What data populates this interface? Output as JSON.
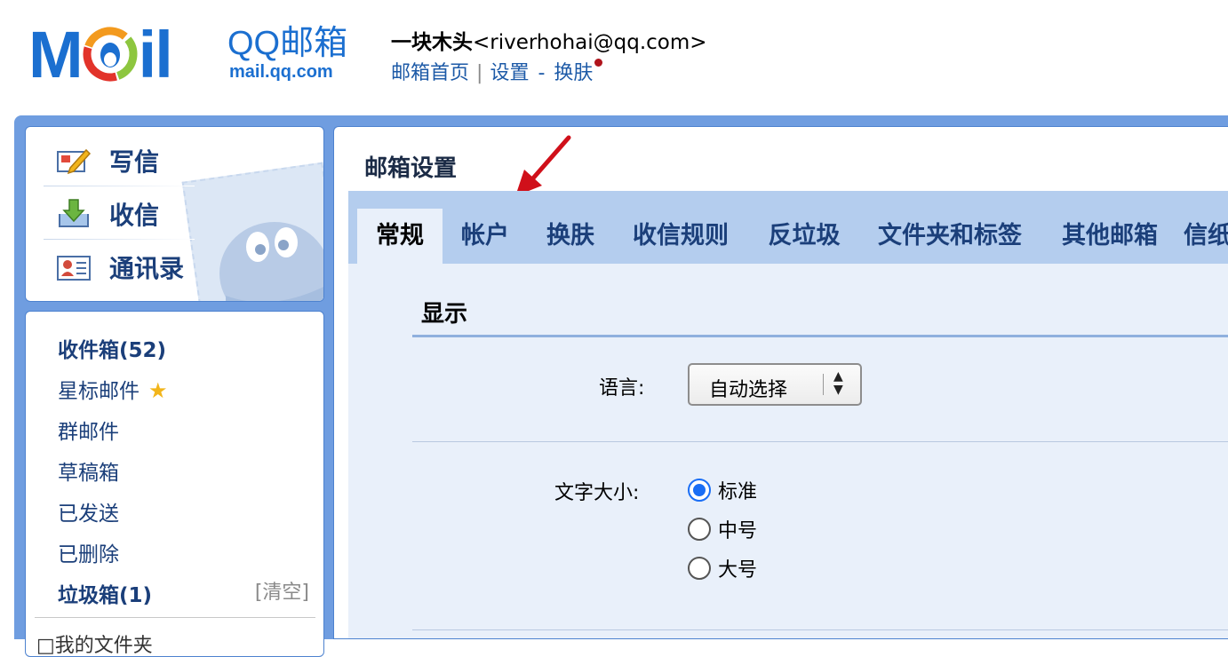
{
  "brand": {
    "logo_text_left": "M",
    "logo_text_right": "il",
    "name": "QQ邮箱",
    "domain": "mail.qq.com"
  },
  "user": {
    "name": "一块木头",
    "email": "<riverhohai@qq.com>"
  },
  "top_links": {
    "home": "邮箱首页",
    "separator": "|",
    "settings": "设置",
    "dash": "-",
    "skin": "换肤"
  },
  "nav": {
    "compose": "写信",
    "inbox_check": "收信",
    "contacts": "通讯录"
  },
  "folders": {
    "inbox": "收件箱(52)",
    "starred": "星标邮件",
    "group": "群邮件",
    "drafts": "草稿箱",
    "sent": "已发送",
    "deleted": "已删除",
    "spam": "垃圾箱(1)",
    "clear": "[清空]",
    "my_folders": "□我的文件夹"
  },
  "main": {
    "title": "邮箱设置",
    "tabs": [
      "常规",
      "帐户",
      "换肤",
      "收信规则",
      "反垃圾",
      "文件夹和标签",
      "其他邮箱",
      "信纸"
    ],
    "section_title": "显示",
    "language_label": "语言:",
    "language_value": "自动选择",
    "font_size_label": "文字大小:",
    "font_options": [
      "标准",
      "中号",
      "大号"
    ],
    "font_selected": "标准"
  },
  "colors": {
    "brand_blue": "#1b6fd0",
    "frame_blue": "#6f9de0",
    "tab_bar": "#b4cdee",
    "content_bg": "#e9f0fa",
    "notify_dot": "#b0141c",
    "annotation_arrow": "#d0101a"
  },
  "icons": {
    "compose": "compose-icon",
    "inbox_check": "download-icon",
    "contacts": "contact-card-icon",
    "starred": "star-icon",
    "arrow": "red-arrow-annotation"
  }
}
